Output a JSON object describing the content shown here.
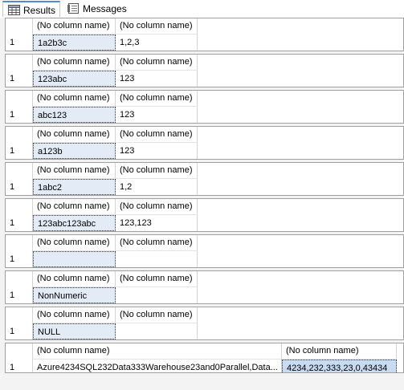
{
  "tabs": {
    "results_label": "Results",
    "messages_label": "Messages"
  },
  "grids": [
    {
      "header": [
        "(No column name)",
        "(No column name)"
      ],
      "row": [
        "1",
        "1a2b3c",
        "1,2,3"
      ]
    },
    {
      "header": [
        "(No column name)",
        "(No column name)"
      ],
      "row": [
        "1",
        "123abc",
        "123"
      ]
    },
    {
      "header": [
        "(No column name)",
        "(No column name)"
      ],
      "row": [
        "1",
        "abc123",
        "123"
      ]
    },
    {
      "header": [
        "(No column name)",
        "(No column name)"
      ],
      "row": [
        "1",
        "a123b",
        "123"
      ]
    },
    {
      "header": [
        "(No column name)",
        "(No column name)"
      ],
      "row": [
        "1",
        "1abc2",
        "1,2"
      ]
    },
    {
      "header": [
        "(No column name)",
        "(No column name)"
      ],
      "row": [
        "1",
        "123abc123abc",
        "123,123"
      ]
    },
    {
      "header": [
        "(No column name)",
        "(No column name)"
      ],
      "row": [
        "1",
        "",
        ""
      ]
    },
    {
      "header": [
        "(No column name)",
        "(No column name)"
      ],
      "row": [
        "1",
        "NonNumeric",
        ""
      ]
    },
    {
      "header": [
        "(No column name)",
        "(No column name)"
      ],
      "row": [
        "1",
        "NULL",
        ""
      ]
    },
    {
      "header": [
        "(No column name)",
        "(No column name)"
      ],
      "row": [
        "1",
        "Azure4234SQL232Data333Warehouse23and0Parallel,Data...",
        "4234,232,333,23,0,43434"
      ]
    }
  ]
}
